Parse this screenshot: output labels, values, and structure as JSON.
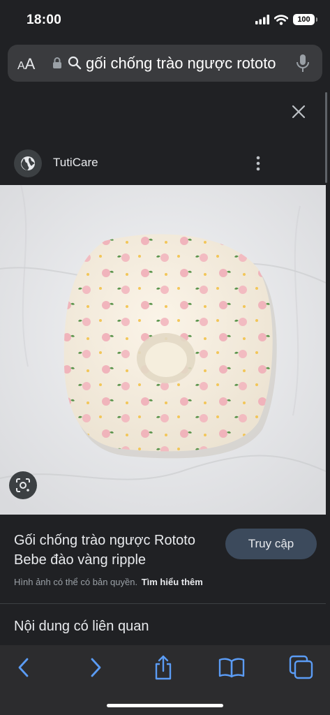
{
  "status_bar": {
    "time": "18:00",
    "battery": "100"
  },
  "address_bar": {
    "reader_button": {
      "large": "A",
      "small": "A"
    },
    "query": "gối chống trào ngược rototo"
  },
  "result": {
    "source_name": "TutiCare",
    "title": "Gối chống trào ngược Rototo Bebe đào vàng ripple",
    "visit_label": "Truy cập",
    "copyright_text": "Hình ảnh có thể có bản quyền.",
    "learn_more": "Tìm hiểu thêm",
    "related_heading": "Nội dung có liên quan"
  },
  "colors": {
    "accent": "#5b9cf5",
    "panel": "#202124",
    "button": "#3c4a5c"
  },
  "toolbar": {
    "items": [
      "back-icon",
      "forward-icon",
      "share-icon",
      "bookmarks-icon",
      "tabs-icon"
    ]
  }
}
